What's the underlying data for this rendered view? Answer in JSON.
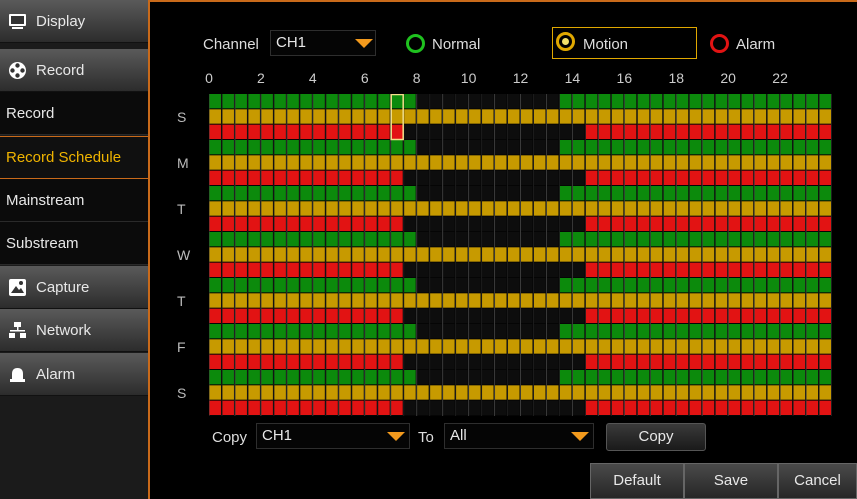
{
  "sidebar": {
    "display": "Display",
    "record": "Record",
    "record_sub": "Record",
    "record_schedule": "Record Schedule",
    "mainstream": "Mainstream",
    "substream": "Substream",
    "capture": "Capture",
    "network": "Network",
    "alarm": "Alarm"
  },
  "header": {
    "channel_label": "Channel",
    "channel_value": "CH1",
    "modes": [
      "Normal",
      "Motion",
      "Alarm"
    ],
    "selected_mode": "Motion"
  },
  "hour_ticks": [
    "0",
    "2",
    "4",
    "6",
    "8",
    "10",
    "12",
    "14",
    "16",
    "18",
    "20",
    "22"
  ],
  "days": [
    "S",
    "M",
    "T",
    "W",
    "T",
    "F",
    "S"
  ],
  "schedule": {
    "slots_per_hour": 2,
    "normal_slots": [
      [
        0,
        16
      ],
      [
        27,
        48
      ]
    ],
    "motion_slots": [
      [
        0,
        48
      ]
    ],
    "alarm_slots": [
      [
        0,
        15
      ],
      [
        29,
        48
      ]
    ]
  },
  "colors": {
    "accent": "#c96a1a",
    "normal": "#0c8a0c",
    "motion": "#c79a00",
    "alarm": "#e21313",
    "empty": "#0d0d0d"
  },
  "copy": {
    "label": "Copy",
    "from_value": "CH1",
    "to_label": "To",
    "to_value": "All",
    "button": "Copy"
  },
  "footer": {
    "default": "Default",
    "save": "Save",
    "cancel": "Cancel"
  }
}
